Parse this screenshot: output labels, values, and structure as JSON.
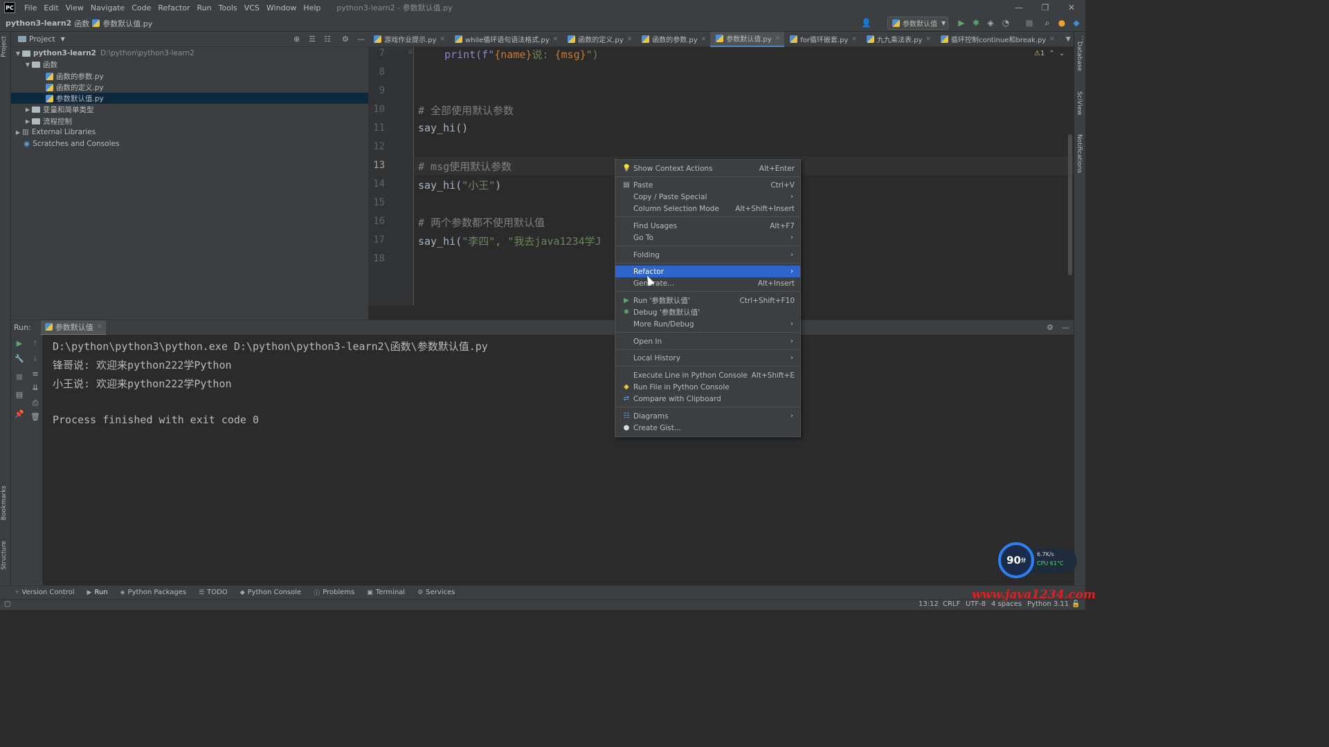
{
  "app": {
    "logo": "PC",
    "menu": [
      "File",
      "Edit",
      "View",
      "Navigate",
      "Code",
      "Refactor",
      "Run",
      "Tools",
      "VCS",
      "Window",
      "Help"
    ],
    "window_title": "python3-learn2 - 参数默认值.py"
  },
  "navbar": {
    "project": "python3-learn2",
    "folder": "函数",
    "file": "参数默认值.py",
    "run_config": "参数默认值"
  },
  "project_panel": {
    "title": "Project",
    "tree": [
      {
        "label": "python3-learn2",
        "path": "D:\\python\\python3-learn2"
      },
      {
        "label": "函数"
      },
      {
        "label": "函数的参数.py"
      },
      {
        "label": "函数的定义.py"
      },
      {
        "label": "参数默认值.py"
      },
      {
        "label": "变量和简单类型"
      },
      {
        "label": "流程控制"
      },
      {
        "label": "External Libraries"
      },
      {
        "label": "Scratches and Consoles"
      }
    ]
  },
  "tabs": [
    {
      "label": "游戏作业提示.py"
    },
    {
      "label": "while循环语句语法格式.py"
    },
    {
      "label": "函数的定义.py"
    },
    {
      "label": "函数的参数.py"
    },
    {
      "label": "参数默认值.py"
    },
    {
      "label": "for循环嵌套.py"
    },
    {
      "label": "九九乘法表.py"
    },
    {
      "label": "循环控制continue和break.py"
    }
  ],
  "editor": {
    "warning_count": "1",
    "line_numbers": [
      "7",
      "8",
      "9",
      "10",
      "11",
      "12",
      "13",
      "14",
      "15",
      "16",
      "17",
      "18"
    ],
    "lines": {
      "l7_a": "print(f\"",
      "l7_b": "{name}",
      "l7_c": "说: ",
      "l7_d": "{msg}",
      "l7_e": "\")",
      "l10": "# 全部使用默认参数",
      "l11": "say_hi()",
      "l13": "# msg使用默认参数",
      "l14_a": "say_hi(",
      "l14_b": "\"小王\"",
      "l14_c": ")",
      "l16": "# 两个参数都不使用默认值",
      "l17_a": "say_hi(",
      "l17_b": "\"李四\"",
      "l17_c": ", ",
      "l17_d": "\"我去java1234学J"
    }
  },
  "run_panel": {
    "label": "Run:",
    "tab": "参数默认值",
    "output": [
      "D:\\python\\python3\\python.exe D:\\python\\python3-learn2\\函数\\参数默认值.py",
      "锋哥说: 欢迎来python222学Python",
      "小王说: 欢迎来python222学Python",
      "",
      "Process finished with exit code 0"
    ]
  },
  "context_menu": {
    "items": [
      {
        "label": "Show Context Actions",
        "shortcut": "Alt+Enter",
        "icon": "bulb-icon"
      },
      {
        "label": "Paste",
        "shortcut": "Ctrl+V",
        "icon": "clipboard-icon"
      },
      {
        "label": "Copy / Paste Special",
        "shortcut": ""
      },
      {
        "label": "Column Selection Mode",
        "shortcut": "Alt+Shift+Insert"
      },
      {
        "label": "Find Usages",
        "shortcut": "Alt+F7"
      },
      {
        "label": "Go To",
        "shortcut": ""
      },
      {
        "label": "Folding",
        "shortcut": ""
      },
      {
        "label": "Refactor",
        "shortcut": ""
      },
      {
        "label": "Generate...",
        "shortcut": "Alt+Insert"
      },
      {
        "label": "Run '参数默认值'",
        "shortcut": "Ctrl+Shift+F10",
        "icon": "run-icon"
      },
      {
        "label": "Debug '参数默认值'",
        "shortcut": "",
        "icon": "debug-icon"
      },
      {
        "label": "More Run/Debug",
        "shortcut": ""
      },
      {
        "label": "Open In",
        "shortcut": ""
      },
      {
        "label": "Local History",
        "shortcut": ""
      },
      {
        "label": "Execute Line in Python Console",
        "shortcut": "Alt+Shift+E"
      },
      {
        "label": "Run File in Python Console",
        "shortcut": "",
        "icon": "python-icon"
      },
      {
        "label": "Compare with Clipboard",
        "shortcut": "",
        "icon": "compare-icon"
      },
      {
        "label": "Diagrams",
        "shortcut": "",
        "icon": "diagram-icon"
      },
      {
        "label": "Create Gist...",
        "shortcut": "",
        "icon": "github-icon"
      }
    ]
  },
  "bottom_tools": [
    "Version Control",
    "Run",
    "Python Packages",
    "TODO",
    "Python Console",
    "Problems",
    "Terminal",
    "Services"
  ],
  "left_stripe": {
    "project": "Project",
    "bookmarks": "Bookmarks",
    "structure": "Structure"
  },
  "right_stripe": {
    "database": "Database",
    "sciview": "SciView",
    "notifications": "Notifications"
  },
  "status": {
    "position": "13:12",
    "line_sep": "CRLF",
    "encoding": "UTF-8",
    "indent": "4 spaces",
    "interpreter": "Python 3.11"
  },
  "overlay": {
    "score": "90",
    "unit": "分",
    "net_speed": "6.7K/s",
    "cpu": "CPU 61°C",
    "watermark": "www.java1234.com"
  },
  "colors": {
    "selection": "#2f65ca",
    "accent": "#4a88c7",
    "background": "#2b2b2b",
    "panel": "#3c3f41"
  }
}
